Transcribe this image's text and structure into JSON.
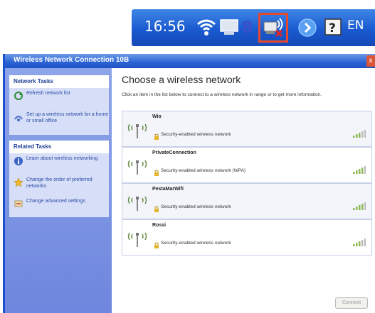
{
  "tray": {
    "clock": "16:56",
    "language": "EN",
    "icons": [
      "wifi-signal-icon",
      "monitor-icon",
      "8-icon",
      "wireless-disconnected-icon",
      "show-hidden-icons-chevron-icon",
      "help-icon"
    ]
  },
  "window": {
    "title": "Wireless Network Connection 10B",
    "close_label": "x"
  },
  "sidebar": {
    "network_tasks": {
      "header": "Network Tasks",
      "items": [
        {
          "label": "Refresh network list",
          "icon": "refresh-icon"
        },
        {
          "label": "Set up a wireless network for a home or small office",
          "icon": "setup-network-icon"
        }
      ]
    },
    "related_tasks": {
      "header": "Related Tasks",
      "items": [
        {
          "label": "Learn about wireless networking",
          "icon": "info-icon"
        },
        {
          "label": "Change the order of preferred networks",
          "icon": "star-icon"
        },
        {
          "label": "Change advanced settings",
          "icon": "settings-icon"
        }
      ]
    }
  },
  "main": {
    "heading": "Choose a wireless network",
    "instructions": "Click an item in the list below to connect to a wireless network in range or to get more information.",
    "networks": [
      {
        "ssid": "Wio",
        "security": "Security-enabled wireless network"
      },
      {
        "ssid": "PrivateConnection",
        "security": "Security-enabled wireless network (WPA)"
      },
      {
        "ssid": "PestaMarWifi",
        "security": "Security-enabled wireless network"
      },
      {
        "ssid": "Rossi",
        "security": "Security-enabled wireless network"
      }
    ],
    "connect_label": "Connect"
  },
  "colors": {
    "taskbar": "#2563d6",
    "titlebar": "#2c63d4",
    "highlight_box": "#e64a2e",
    "task_pane": "#7a91e2"
  }
}
